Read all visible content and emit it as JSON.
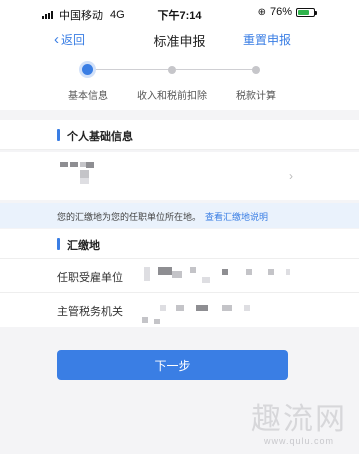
{
  "status_bar": {
    "carrier": "中国移动",
    "network": "4G",
    "time": "下午7:14",
    "battery_percent": "76%",
    "battery_level": 0.76
  },
  "nav": {
    "back_label": "返回",
    "title": "标准申报",
    "action_label": "重置申报"
  },
  "steps": [
    {
      "label": "基本信息",
      "active": true
    },
    {
      "label": "收入和税前扣除",
      "active": false
    },
    {
      "label": "税款计算",
      "active": false
    }
  ],
  "personal_section": {
    "title": "个人基础信息"
  },
  "note": {
    "text": "您的汇缴地为您的任职单位所在地。",
    "link": "查看汇缴地说明"
  },
  "remit_section": {
    "title": "汇缴地",
    "fields": [
      {
        "label": "任职受雇单位"
      },
      {
        "label": "主管税务机关"
      }
    ]
  },
  "next_button": "下一步",
  "watermark": {
    "text": "趣流网",
    "url": "www.qulu.com"
  },
  "colors": {
    "accent": "#3a7ee4",
    "note_bg": "#eaf2fc",
    "page_bg": "#f4f4f6"
  }
}
